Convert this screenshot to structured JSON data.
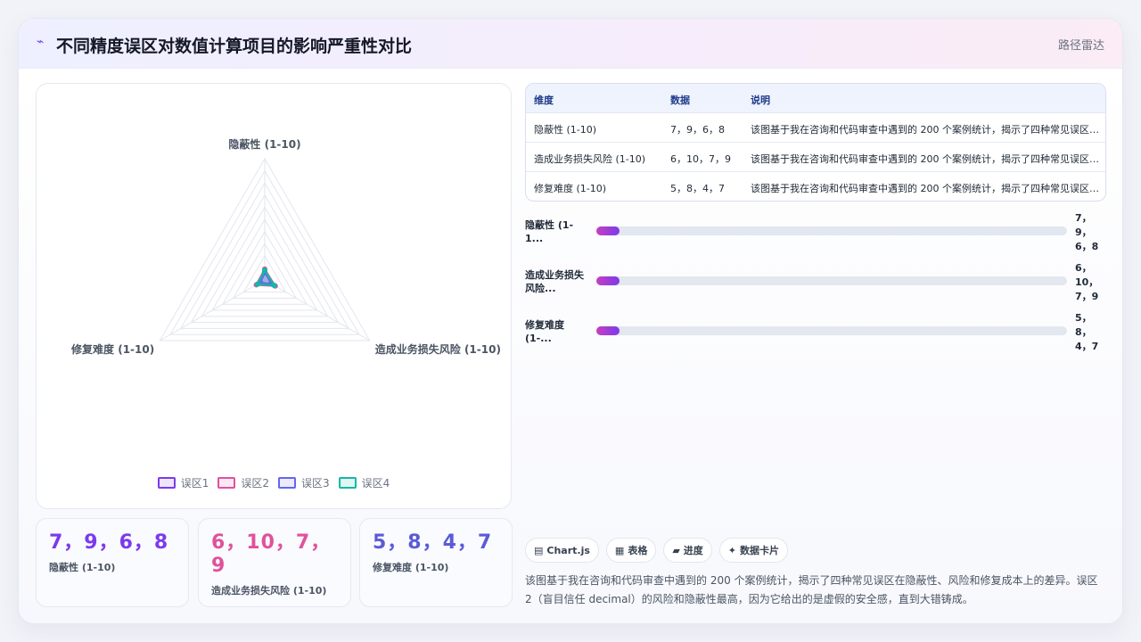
{
  "header": {
    "icon": "wave-icon",
    "title": "不同精度误区对数值计算项目的影响严重性对比",
    "right_label": "路径雷达"
  },
  "chart_data": {
    "type": "radar",
    "axes": [
      "隐蔽性 (1-10)",
      "造成业务损失风险 (1-10)",
      "修复难度 (1-10)"
    ],
    "series": [
      {
        "name": "误区1",
        "values": [
          7,
          6,
          5
        ],
        "color": "#7c3aed"
      },
      {
        "name": "误区2",
        "values": [
          9,
          10,
          8
        ],
        "color": "#e0529c"
      },
      {
        "name": "误区3",
        "values": [
          6,
          7,
          4
        ],
        "color": "#6366f1"
      },
      {
        "name": "误区4",
        "values": [
          8,
          9,
          7
        ],
        "color": "#14b8a6"
      }
    ],
    "range": [
      0,
      10
    ],
    "grid": true,
    "legend_position": "bottom"
  },
  "stats": [
    {
      "value": "7，9，6，8",
      "label": "隐蔽性 (1-10)",
      "color": "#7c3aed"
    },
    {
      "value": "6，10，7，9",
      "label": "造成业务损失风险 (1-10)",
      "color": "#e0529c"
    },
    {
      "value": "5，8，4，7",
      "label": "修复难度 (1-10)",
      "color": "#5b5bd6"
    }
  ],
  "table": {
    "headers": [
      "维度",
      "数据",
      "说明"
    ],
    "rows": [
      [
        "隐蔽性 (1-10)",
        "7，9，6，8",
        "该图基于我在咨询和代码审查中遇到的 200 个案例统计，揭示了四种常见误区在隐蔽性、风险和修复成本上的差异。"
      ],
      [
        "造成业务损失风险 (1-10)",
        "6，10，7，9",
        "该图基于我在咨询和代码审查中遇到的 200 个案例统计，揭示了四种常见误区在隐蔽性、风险和修复成本上的差异。"
      ],
      [
        "修复难度 (1-10)",
        "5，8，4，7",
        "该图基于我在咨询和代码审查中遇到的 200 个案例统计，揭示了四种常见误区在隐蔽性、风险和修复成本上的差异。"
      ]
    ]
  },
  "progress": [
    {
      "label_lines": [
        "隐蔽性 (1-",
        "1..."
      ],
      "value_lines": [
        "7，",
        "9，",
        "6，8"
      ],
      "fill": 0.05
    },
    {
      "label_lines": [
        "造成业务损失",
        "风险..."
      ],
      "value_lines": [
        "6，",
        "10，",
        "7，9"
      ],
      "fill": 0.05
    },
    {
      "label_lines": [
        "修复难度",
        "(1-..."
      ],
      "value_lines": [
        "5，",
        "8，",
        "4，7"
      ],
      "fill": 0.05
    }
  ],
  "chips": [
    {
      "icon": "chart-icon",
      "glyph": "▤",
      "label": "Chart.js"
    },
    {
      "icon": "table-icon",
      "glyph": "▦",
      "label": "表格"
    },
    {
      "icon": "progress-icon",
      "glyph": "▰",
      "label": "进度"
    },
    {
      "icon": "card-icon",
      "glyph": "✦",
      "label": "数据卡片"
    }
  ],
  "summary": "该图基于我在咨询和代码审查中遇到的 200 个案例统计，揭示了四种常见误区在隐蔽性、风险和修复成本上的差异。误区 2（盲目信任 decimal）的风险和隐蔽性最高，因为它给出的是虚假的安全感，直到大错铸成。"
}
